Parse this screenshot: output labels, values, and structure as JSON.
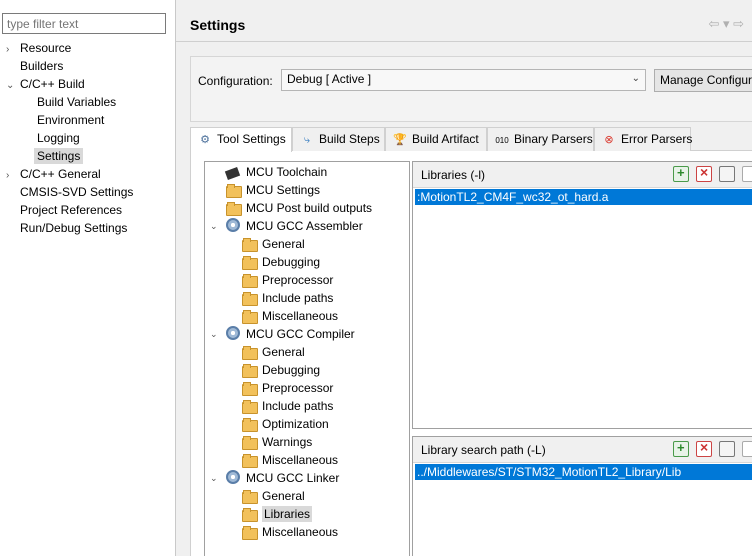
{
  "filter": {
    "placeholder": "type filter text"
  },
  "nav": [
    {
      "label": "Resource",
      "arrow": "›"
    },
    {
      "label": "Builders",
      "arrow": ""
    },
    {
      "label": "C/C++ Build",
      "arrow": "⌄"
    },
    {
      "label": "Build Variables",
      "arrow": ""
    },
    {
      "label": "Environment",
      "arrow": ""
    },
    {
      "label": "Logging",
      "arrow": ""
    },
    {
      "label": "Settings",
      "arrow": ""
    },
    {
      "label": "C/C++ General",
      "arrow": "›"
    },
    {
      "label": "CMSIS-SVD Settings",
      "arrow": ""
    },
    {
      "label": "Project References",
      "arrow": ""
    },
    {
      "label": "Run/Debug Settings",
      "arrow": ""
    }
  ],
  "header": {
    "title": "Settings"
  },
  "config": {
    "label": "Configuration:",
    "value": "Debug  [ Active ]",
    "manage_label": "Manage Configurations..."
  },
  "tabs": [
    {
      "label": "Tool Settings",
      "icon": "tool-settings-icon"
    },
    {
      "label": "Build Steps",
      "icon": "build-steps-icon"
    },
    {
      "label": "Build Artifact",
      "icon": "build-artifact-icon"
    },
    {
      "label": "Binary Parsers",
      "icon": "binary-parsers-icon"
    },
    {
      "label": "Error Parsers",
      "icon": "error-parsers-icon"
    }
  ],
  "tree": [
    {
      "label": "MCU Toolchain",
      "level": 0,
      "icon": "chip",
      "expand": ""
    },
    {
      "label": "MCU Settings",
      "level": 0,
      "icon": "folder",
      "expand": ""
    },
    {
      "label": "MCU Post build outputs",
      "level": 0,
      "icon": "folder",
      "expand": ""
    },
    {
      "label": "MCU GCC Assembler",
      "level": 0,
      "icon": "gear",
      "expand": "⌄"
    },
    {
      "label": "General",
      "level": 1,
      "icon": "folder",
      "expand": ""
    },
    {
      "label": "Debugging",
      "level": 1,
      "icon": "folder",
      "expand": ""
    },
    {
      "label": "Preprocessor",
      "level": 1,
      "icon": "folder",
      "expand": ""
    },
    {
      "label": "Include paths",
      "level": 1,
      "icon": "folder",
      "expand": ""
    },
    {
      "label": "Miscellaneous",
      "level": 1,
      "icon": "folder",
      "expand": ""
    },
    {
      "label": "MCU GCC Compiler",
      "level": 0,
      "icon": "gear",
      "expand": "⌄"
    },
    {
      "label": "General",
      "level": 1,
      "icon": "folder",
      "expand": ""
    },
    {
      "label": "Debugging",
      "level": 1,
      "icon": "folder",
      "expand": ""
    },
    {
      "label": "Preprocessor",
      "level": 1,
      "icon": "folder",
      "expand": ""
    },
    {
      "label": "Include paths",
      "level": 1,
      "icon": "folder",
      "expand": ""
    },
    {
      "label": "Optimization",
      "level": 1,
      "icon": "folder",
      "expand": ""
    },
    {
      "label": "Warnings",
      "level": 1,
      "icon": "folder",
      "expand": ""
    },
    {
      "label": "Miscellaneous",
      "level": 1,
      "icon": "folder",
      "expand": ""
    },
    {
      "label": "MCU GCC Linker",
      "level": 0,
      "icon": "gear",
      "expand": "⌄"
    },
    {
      "label": "General",
      "level": 1,
      "icon": "folder",
      "expand": ""
    },
    {
      "label": "Libraries",
      "level": 1,
      "icon": "folder",
      "expand": ""
    },
    {
      "label": "Miscellaneous",
      "level": 1,
      "icon": "folder",
      "expand": ""
    }
  ],
  "libraries": {
    "title": "Libraries (-l)",
    "items": [
      ":MotionTL2_CM4F_wc32_ot_hard.a"
    ]
  },
  "search_path": {
    "title": "Library search path (-L)",
    "items": [
      "../Middlewares/ST/STM32_MotionTL2_Library/Lib"
    ]
  }
}
